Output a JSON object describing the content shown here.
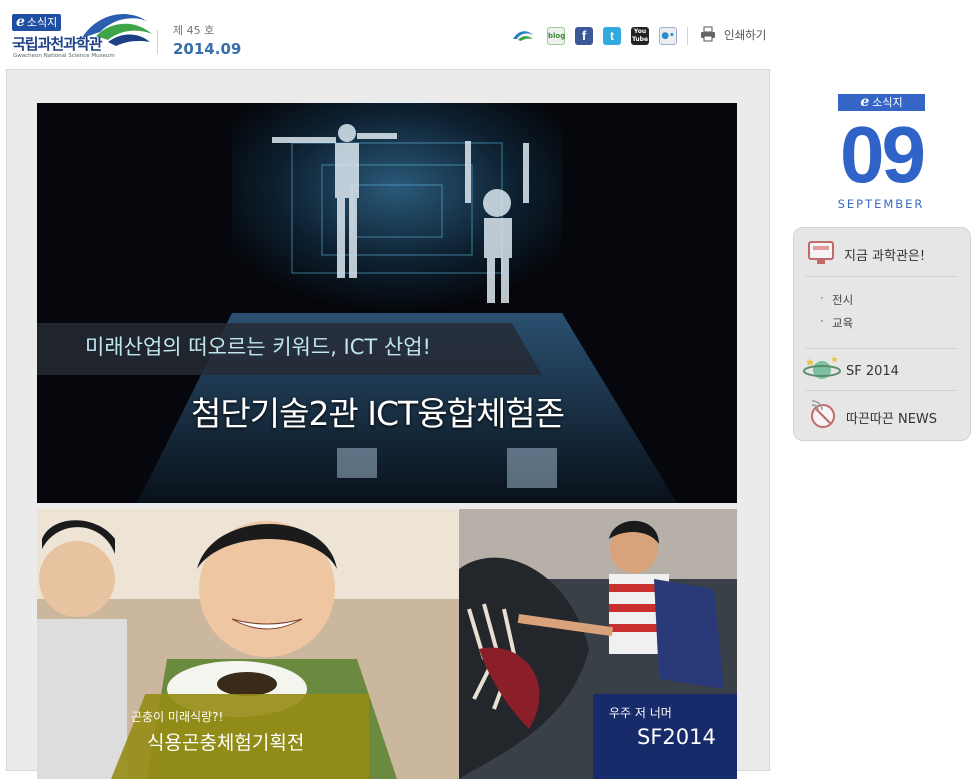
{
  "header": {
    "logo_badge_e": "e",
    "logo_badge_text": "소식지",
    "museum_name": "국립과천과학관",
    "museum_name_en": "Gwacheon National Science Museum",
    "issue_no": "제 45 호",
    "issue_date": "2014.09",
    "social": [
      {
        "name": "museum-icon",
        "label": ""
      },
      {
        "name": "blog-icon",
        "label": "blog"
      },
      {
        "name": "facebook-icon",
        "label": "f"
      },
      {
        "name": "twitter-icon",
        "label": "t"
      },
      {
        "name": "youtube-icon",
        "label": "You Tube"
      },
      {
        "name": "flickr-icon",
        "label": "●•"
      }
    ],
    "print_label": "인쇄하기"
  },
  "hero": {
    "subtitle": "미래산업의 떠오르는 키워드, ICT 산업!",
    "title": "첨단기술2관 ICT융합체험존"
  },
  "cards": [
    {
      "small": "곤충이 미래식량?!",
      "title": "식용곤충체험기획전"
    },
    {
      "small": "우주 저 너머",
      "title": "SF2014"
    }
  ],
  "sidebar": {
    "badge_e": "e",
    "badge_text": "소식지",
    "month_number": "09",
    "month_name": "SEPTEMBER",
    "menu_title": "지금 과학관은!",
    "menu_items": [
      "전시",
      "교육"
    ],
    "sf_label": "SF 2014",
    "news_label": "따끈따끈 NEWS"
  },
  "colors": {
    "brand_blue": "#2f63c8",
    "hero_subtitle": "#bfe7f0",
    "card1_overlay": "#968c14",
    "card2_overlay": "#14286e"
  }
}
